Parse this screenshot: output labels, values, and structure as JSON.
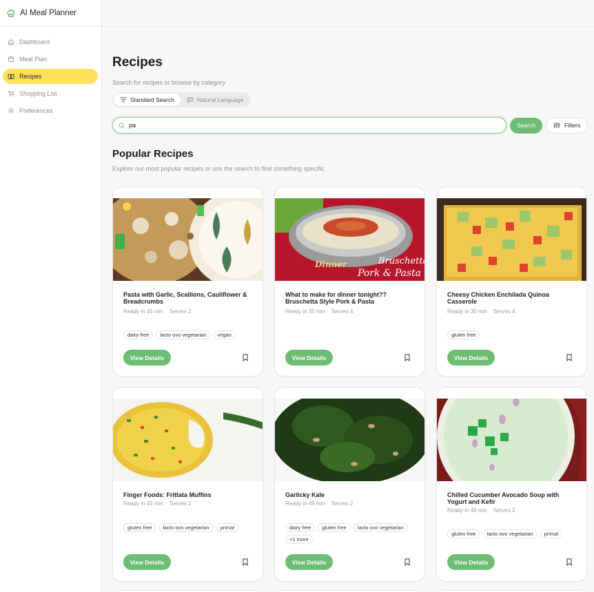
{
  "app": {
    "title": "AI Meal Planner",
    "accent": "#ffe05a",
    "green": "#6dbd74"
  },
  "sidebar": {
    "items": [
      {
        "label": "Dashboard",
        "icon": "home-icon"
      },
      {
        "label": "Meal Plan",
        "icon": "calendar-icon"
      },
      {
        "label": "Recipes",
        "icon": "book-icon",
        "active": true
      },
      {
        "label": "Shopping List",
        "icon": "cart-icon"
      },
      {
        "label": "Preferences",
        "icon": "gear-icon"
      }
    ]
  },
  "page": {
    "title": "Recipes",
    "subtitle": "Search for recipes or browse by category"
  },
  "mode": {
    "standard": "Standard Search",
    "natural": "Natural Language",
    "selected": "Standard Search"
  },
  "search": {
    "value": "pa",
    "button": "Search",
    "filters": "Filters"
  },
  "popular": {
    "title": "Popular Recipes",
    "subtitle": "Explore our most popular recipes or use the search to find something specific"
  },
  "recipes": [
    {
      "title": "Pasta with Garlic, Scallions, Cauliflower & Breadcrumbs",
      "time": "Ready in 45 min",
      "serves": "Serves 2",
      "tags": [
        "dairy free",
        "lacto ovo vegetarian",
        "vegan"
      ],
      "button": "View Details"
    },
    {
      "title": "What to make for dinner tonight?? Bruschetta Style Pork & Pasta",
      "time": "Ready in 35 min",
      "serves": "Serves 4",
      "tags": [],
      "button": "View Details",
      "image_text": {
        "line1": "Bruschetta Style",
        "line2": "Pork & Pasta",
        "line3": "Dinner"
      }
    },
    {
      "title": "Cheesy Chicken Enchilada Quinoa Casserole",
      "time": "Ready in 30 min",
      "serves": "Serves 4",
      "tags": [
        "gluten free"
      ],
      "button": "View Details"
    },
    {
      "title": "Finger Foods: Frittata Muffins",
      "time": "Ready in 45 min",
      "serves": "Serves 2",
      "tags": [
        "gluten free",
        "lacto ovo vegetarian",
        "primal"
      ],
      "button": "View Details"
    },
    {
      "title": "Garlicky Kale",
      "time": "Ready in 45 min",
      "serves": "Serves 2",
      "tags": [
        "dairy free",
        "gluten free",
        "lacto ovo vegetarian",
        "+1 more"
      ],
      "button": "View Details"
    },
    {
      "title": "Chilled Cucumber Avocado Soup with Yogurt and Kefir",
      "time": "Ready in 45 min",
      "serves": "Serves 2",
      "tags": [
        "gluten free",
        "lacto ovo vegetarian",
        "primal"
      ],
      "button": "View Details"
    }
  ]
}
